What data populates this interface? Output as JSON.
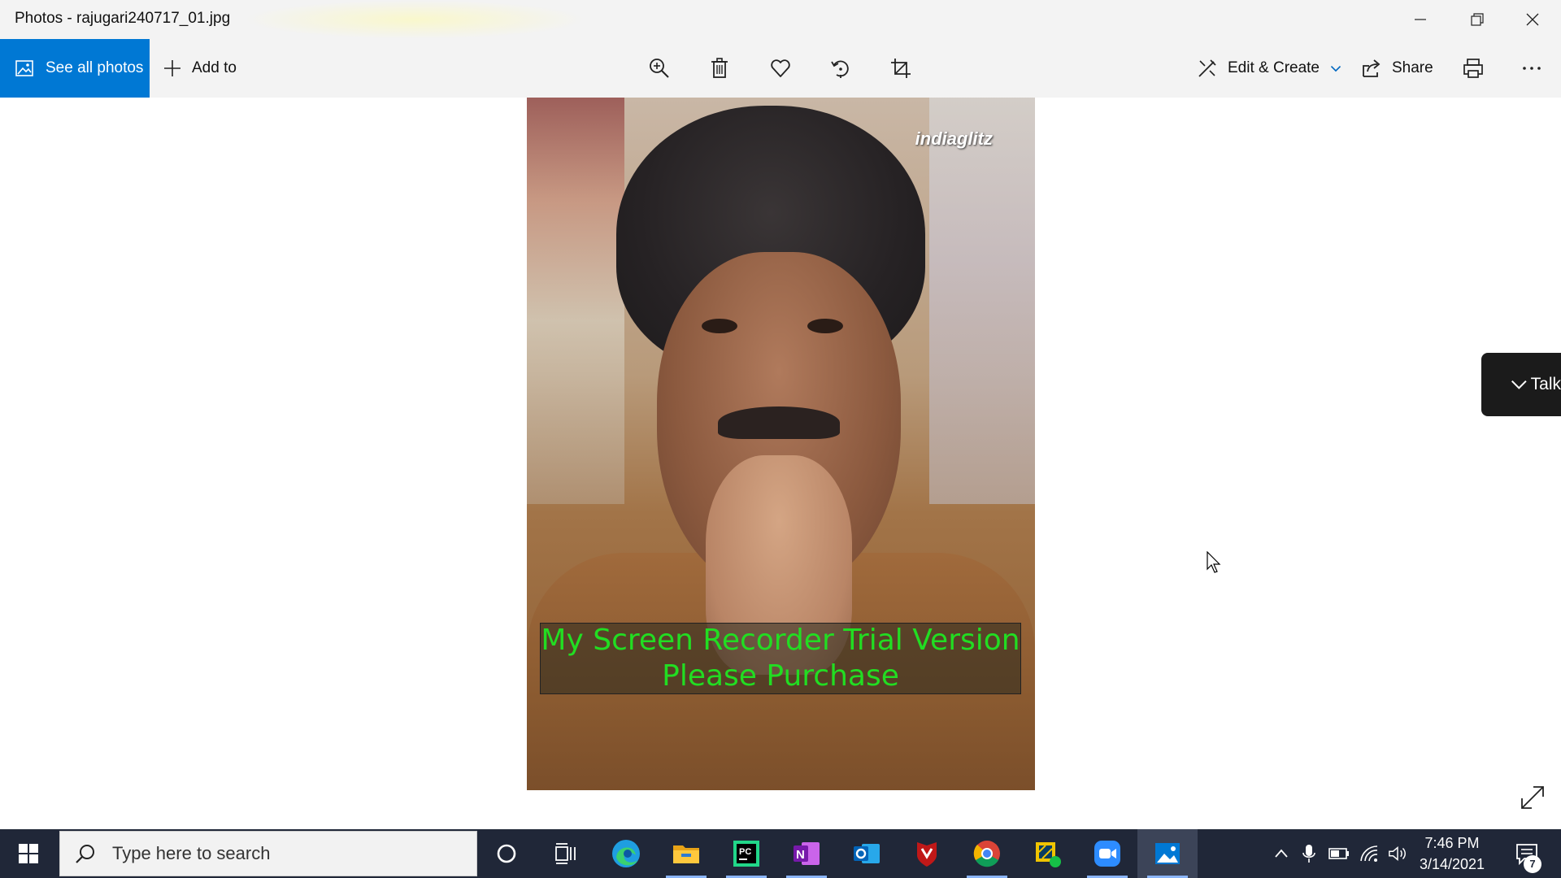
{
  "window": {
    "title": "Photos - rajugari240717_01.jpg"
  },
  "toolbar": {
    "see_all_label": "See all photos",
    "add_to_label": "Add to",
    "edit_create_label": "Edit & Create",
    "share_label": "Share"
  },
  "photo": {
    "watermark": "indiaglitz",
    "overlay_line1": "My Screen Recorder Trial Version",
    "overlay_line2": "Please Purchase"
  },
  "talk_panel": {
    "label": "Talk"
  },
  "taskbar": {
    "search_placeholder": "Type here to search",
    "apps": [
      "cortana-icon",
      "task-view-icon",
      "edge-icon",
      "file-explorer-icon",
      "pycharm-icon",
      "onenote-icon",
      "outlook-icon",
      "mcafee-icon",
      "chrome-icon",
      "app-icon",
      "zoom-icon",
      "photos-icon"
    ],
    "clock_time": "7:46 PM",
    "clock_date": "3/14/2021",
    "notification_count": "7"
  },
  "colors": {
    "accent": "#0078d4",
    "taskbar": "#202738",
    "overlay_text": "#22dd22"
  }
}
